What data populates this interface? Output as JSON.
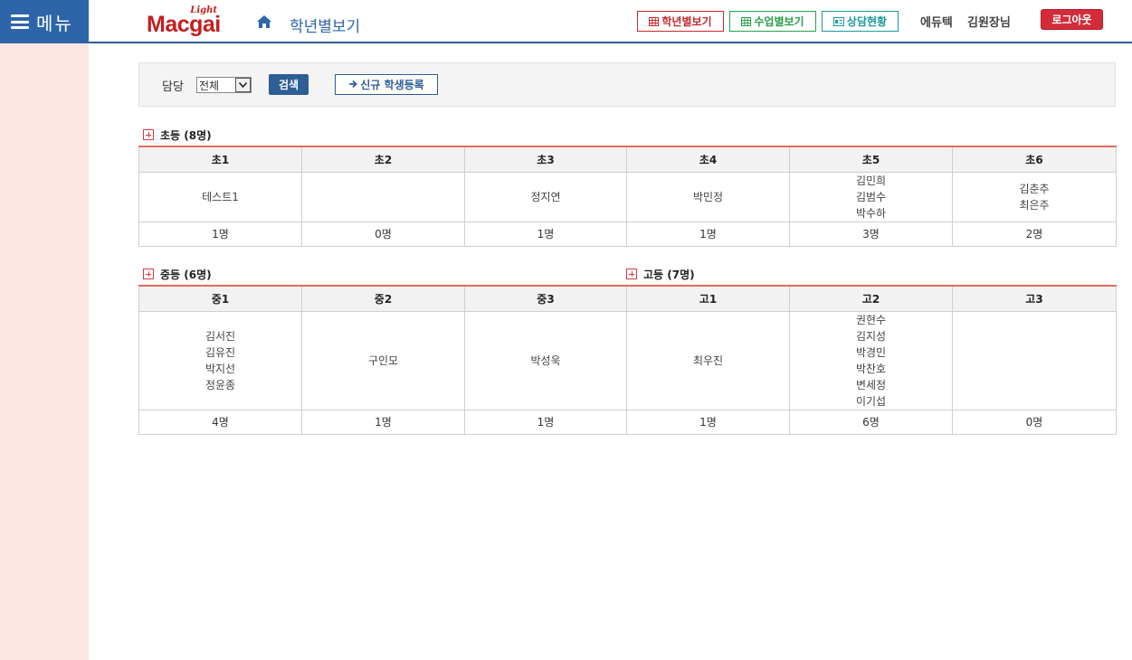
{
  "header": {
    "menu_label": "메뉴",
    "logo_light": "Light",
    "logo_main": "Macgai",
    "page_title": "학년별보기",
    "nav_buttons": {
      "grade_view": "학년별보기",
      "class_view": "수업별보기",
      "consult_status": "상담현황"
    },
    "user_org": "에듀텍",
    "user_name": "김원장님",
    "logout_label": "로그아웃",
    "colors": {
      "brand_blue": "#2d65a8",
      "logout_red": "#d42b3a"
    }
  },
  "search": {
    "label": "담당",
    "select_value": "전체",
    "search_button": "검색",
    "new_student_button": "신규 학생등록"
  },
  "sections": {
    "elementary": {
      "title": "초등 (8명)",
      "grades": [
        {
          "label": "초1",
          "students": [
            "테스트1"
          ],
          "count": "1명"
        },
        {
          "label": "초2",
          "students": [],
          "count": "0명"
        },
        {
          "label": "초3",
          "students": [
            "정지연"
          ],
          "count": "1명"
        },
        {
          "label": "초4",
          "students": [
            "박민정"
          ],
          "count": "1명"
        },
        {
          "label": "초5",
          "students": [
            "김민희",
            "김범수",
            "박수하"
          ],
          "count": "3명"
        },
        {
          "label": "초6",
          "students": [
            "김춘추",
            "최은주"
          ],
          "count": "2명"
        }
      ]
    },
    "middle": {
      "title": "중등 (6명)",
      "grades": [
        {
          "label": "중1",
          "students": [
            "김서진",
            "김유진",
            "박지선",
            "정윤종"
          ],
          "count": "4명"
        },
        {
          "label": "중2",
          "students": [
            "구인모"
          ],
          "count": "1명"
        },
        {
          "label": "중3",
          "students": [
            "박성욱"
          ],
          "count": "1명"
        }
      ]
    },
    "high": {
      "title": "고등 (7명)",
      "grades": [
        {
          "label": "고1",
          "students": [
            "최우진"
          ],
          "count": "1명"
        },
        {
          "label": "고2",
          "students": [
            "권현수",
            "김지성",
            "박경민",
            "박찬호",
            "변세정",
            "이기섭"
          ],
          "count": "6명"
        },
        {
          "label": "고3",
          "students": [],
          "count": "0명"
        }
      ]
    }
  }
}
